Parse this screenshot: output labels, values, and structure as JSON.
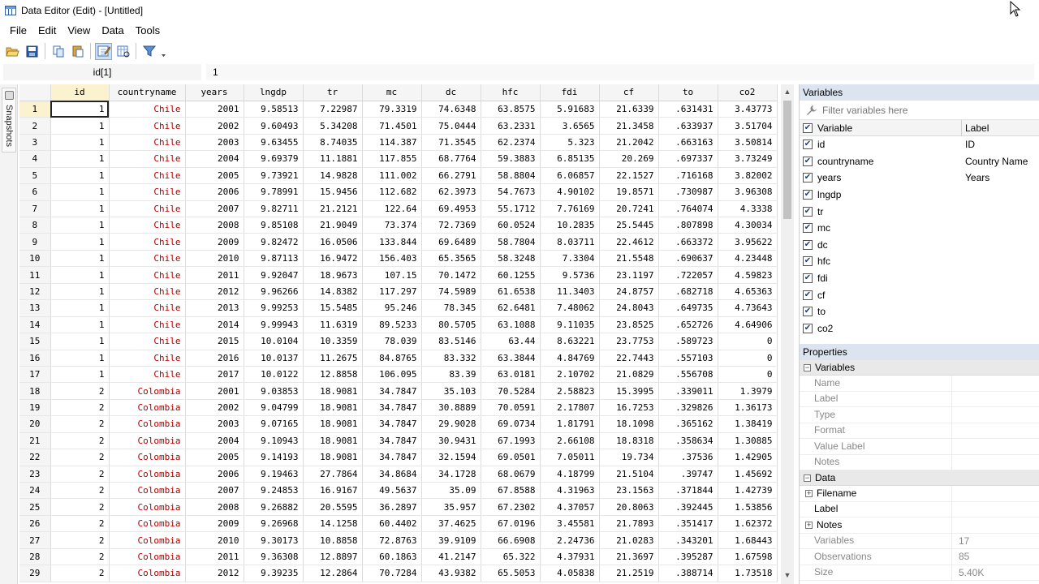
{
  "window": {
    "title": "Data Editor (Edit) - [Untitled]"
  },
  "menu": [
    "File",
    "Edit",
    "View",
    "Data",
    "Tools"
  ],
  "toolbar": {
    "icons": [
      "open-icon",
      "save-icon",
      "copy-icon",
      "paste-icon",
      "edit-mode-icon",
      "browse-mode-icon",
      "filter-icon",
      "dropdown-icon"
    ]
  },
  "cellbar": {
    "ref": "id[1]",
    "value": "1"
  },
  "snapshots": {
    "label": "Snapshots"
  },
  "grid": {
    "columns": [
      "id",
      "countryname",
      "years",
      "lngdp",
      "tr",
      "mc",
      "dc",
      "hfc",
      "fdi",
      "cf",
      "to",
      "co2"
    ],
    "rows": [
      [
        "1",
        "1",
        "Chile",
        "2001",
        "9.58513",
        "7.22987",
        "79.3319",
        "74.6348",
        "63.8575",
        "5.91683",
        "21.6339",
        ".631431",
        "3.43773"
      ],
      [
        "2",
        "1",
        "Chile",
        "2002",
        "9.60493",
        "5.34208",
        "71.4501",
        "75.0444",
        "63.2331",
        "3.6565",
        "21.3458",
        ".633937",
        "3.51704"
      ],
      [
        "3",
        "1",
        "Chile",
        "2003",
        "9.63455",
        "8.74035",
        "114.387",
        "71.3545",
        "62.2374",
        "5.323",
        "21.2042",
        ".663163",
        "3.50814"
      ],
      [
        "4",
        "1",
        "Chile",
        "2004",
        "9.69379",
        "11.1881",
        "117.855",
        "68.7764",
        "59.3883",
        "6.85135",
        "20.269",
        ".697337",
        "3.73249"
      ],
      [
        "5",
        "1",
        "Chile",
        "2005",
        "9.73921",
        "14.9828",
        "111.002",
        "66.2791",
        "58.8804",
        "6.06857",
        "22.1527",
        ".716168",
        "3.82002"
      ],
      [
        "6",
        "1",
        "Chile",
        "2006",
        "9.78991",
        "15.9456",
        "112.682",
        "62.3973",
        "54.7673",
        "4.90102",
        "19.8571",
        ".730987",
        "3.96308"
      ],
      [
        "7",
        "1",
        "Chile",
        "2007",
        "9.82711",
        "21.2121",
        "122.64",
        "69.4953",
        "55.1712",
        "7.76169",
        "20.7241",
        ".764074",
        "4.3338"
      ],
      [
        "8",
        "1",
        "Chile",
        "2008",
        "9.85108",
        "21.9049",
        "73.374",
        "72.7369",
        "60.0524",
        "10.2835",
        "25.5445",
        ".807898",
        "4.30034"
      ],
      [
        "9",
        "1",
        "Chile",
        "2009",
        "9.82472",
        "16.0506",
        "133.844",
        "69.6489",
        "58.7804",
        "8.03711",
        "22.4612",
        ".663372",
        "3.95622"
      ],
      [
        "10",
        "1",
        "Chile",
        "2010",
        "9.87113",
        "16.9472",
        "156.403",
        "65.3565",
        "58.3248",
        "7.3304",
        "21.5548",
        ".690637",
        "4.23448"
      ],
      [
        "11",
        "1",
        "Chile",
        "2011",
        "9.92047",
        "18.9673",
        "107.15",
        "70.1472",
        "60.1255",
        "9.5736",
        "23.1197",
        ".722057",
        "4.59823"
      ],
      [
        "12",
        "1",
        "Chile",
        "2012",
        "9.96266",
        "14.8382",
        "117.297",
        "74.5989",
        "61.6538",
        "11.3403",
        "24.8757",
        ".682718",
        "4.65363"
      ],
      [
        "13",
        "1",
        "Chile",
        "2013",
        "9.99253",
        "15.5485",
        "95.246",
        "78.345",
        "62.6481",
        "7.48062",
        "24.8043",
        ".649735",
        "4.73643"
      ],
      [
        "14",
        "1",
        "Chile",
        "2014",
        "9.99943",
        "11.6319",
        "89.5233",
        "80.5705",
        "63.1088",
        "9.11035",
        "23.8525",
        ".652726",
        "4.64906"
      ],
      [
        "15",
        "1",
        "Chile",
        "2015",
        "10.0104",
        "10.3359",
        "78.039",
        "83.5146",
        "63.44",
        "8.63221",
        "23.7753",
        ".589723",
        "0"
      ],
      [
        "16",
        "1",
        "Chile",
        "2016",
        "10.0137",
        "11.2675",
        "84.8765",
        "83.332",
        "63.3844",
        "4.84769",
        "22.7443",
        ".557103",
        "0"
      ],
      [
        "17",
        "1",
        "Chile",
        "2017",
        "10.0122",
        "12.8858",
        "106.095",
        "83.39",
        "63.0181",
        "2.10702",
        "21.0829",
        ".556708",
        "0"
      ],
      [
        "18",
        "2",
        "Colombia",
        "2001",
        "9.03853",
        "18.9081",
        "34.7847",
        "35.103",
        "70.5284",
        "2.58823",
        "15.3995",
        ".339011",
        "1.3979"
      ],
      [
        "19",
        "2",
        "Colombia",
        "2002",
        "9.04799",
        "18.9081",
        "34.7847",
        "30.8889",
        "70.0591",
        "2.17807",
        "16.7253",
        ".329826",
        "1.36173"
      ],
      [
        "20",
        "2",
        "Colombia",
        "2003",
        "9.07165",
        "18.9081",
        "34.7847",
        "29.9028",
        "69.0734",
        "1.81791",
        "18.1098",
        ".365162",
        "1.38419"
      ],
      [
        "21",
        "2",
        "Colombia",
        "2004",
        "9.10943",
        "18.9081",
        "34.7847",
        "30.9431",
        "67.1993",
        "2.66108",
        "18.8318",
        ".358634",
        "1.30885"
      ],
      [
        "22",
        "2",
        "Colombia",
        "2005",
        "9.14193",
        "18.9081",
        "34.7847",
        "32.1594",
        "69.0501",
        "7.05011",
        "19.734",
        ".37536",
        "1.42905"
      ],
      [
        "23",
        "2",
        "Colombia",
        "2006",
        "9.19463",
        "27.7864",
        "34.8684",
        "34.1728",
        "68.0679",
        "4.18799",
        "21.5104",
        ".39747",
        "1.45692"
      ],
      [
        "24",
        "2",
        "Colombia",
        "2007",
        "9.24853",
        "16.9167",
        "49.5637",
        "35.09",
        "67.8588",
        "4.31963",
        "23.1563",
        ".371844",
        "1.42739"
      ],
      [
        "25",
        "2",
        "Colombia",
        "2008",
        "9.26882",
        "20.5595",
        "36.2897",
        "35.957",
        "67.2302",
        "4.37057",
        "20.8063",
        ".392445",
        "1.53856"
      ],
      [
        "26",
        "2",
        "Colombia",
        "2009",
        "9.26968",
        "14.1258",
        "60.4402",
        "37.4625",
        "67.0196",
        "3.45581",
        "21.7893",
        ".351417",
        "1.62372"
      ],
      [
        "27",
        "2",
        "Colombia",
        "2010",
        "9.30173",
        "10.8858",
        "72.8763",
        "39.9109",
        "66.6908",
        "2.24736",
        "21.0283",
        ".343201",
        "1.68443"
      ],
      [
        "28",
        "2",
        "Colombia",
        "2011",
        "9.36308",
        "12.8897",
        "60.1863",
        "41.2147",
        "65.322",
        "4.37931",
        "21.3697",
        ".395287",
        "1.67598"
      ],
      [
        "29",
        "2",
        "Colombia",
        "2012",
        "9.39235",
        "12.2864",
        "70.7284",
        "43.9382",
        "65.5053",
        "4.05838",
        "21.2519",
        ".388714",
        "1.73518"
      ]
    ]
  },
  "variables_pane": {
    "title": "Variables",
    "filter_placeholder": "Filter variables here",
    "header_variable": "Variable",
    "header_label": "Label",
    "items": [
      {
        "name": "id",
        "label": "ID"
      },
      {
        "name": "countryname",
        "label": "Country Name"
      },
      {
        "name": "years",
        "label": "Years"
      },
      {
        "name": "lngdp",
        "label": ""
      },
      {
        "name": "tr",
        "label": ""
      },
      {
        "name": "mc",
        "label": ""
      },
      {
        "name": "dc",
        "label": ""
      },
      {
        "name": "hfc",
        "label": ""
      },
      {
        "name": "fdi",
        "label": ""
      },
      {
        "name": "cf",
        "label": ""
      },
      {
        "name": "to",
        "label": ""
      },
      {
        "name": "co2",
        "label": ""
      }
    ]
  },
  "properties_pane": {
    "title": "Properties",
    "variables_section": "Variables",
    "variable_fields": [
      "Name",
      "Label",
      "Type",
      "Format",
      "Value Label",
      "Notes"
    ],
    "data_section": "Data",
    "data_fields": [
      {
        "key": "Filename",
        "value": "",
        "expandable": true
      },
      {
        "key": "Label",
        "value": "",
        "expandable": false
      },
      {
        "key": "Notes",
        "value": "",
        "expandable": true
      },
      {
        "key": "Variables",
        "value": "17",
        "expandable": false
      },
      {
        "key": "Observations",
        "value": "85",
        "expandable": false
      },
      {
        "key": "Size",
        "value": "5.40K",
        "expandable": false
      }
    ]
  },
  "colors": {
    "string_text": "#b00000",
    "pane_header": "#dbe4ef",
    "selected_header": "#fbf2d0"
  }
}
